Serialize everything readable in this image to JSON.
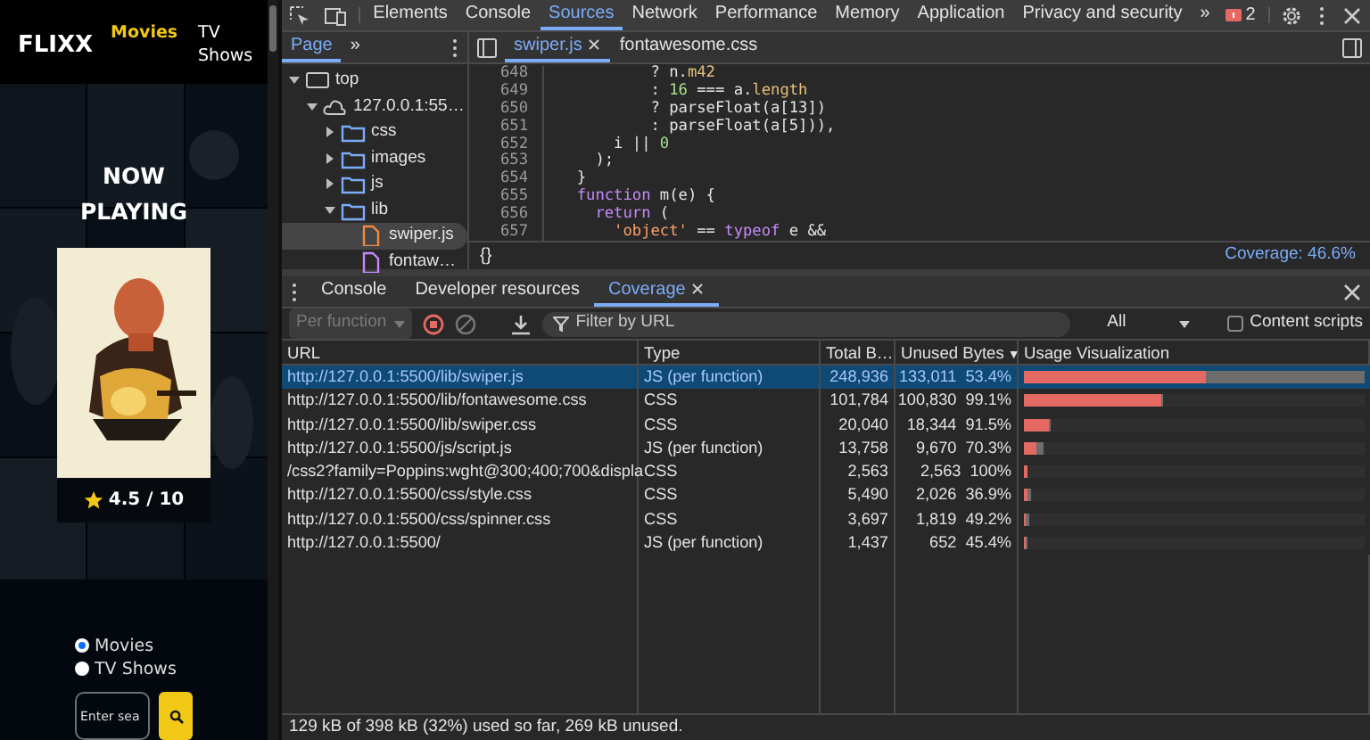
{
  "website": {
    "logo": "FLIXX",
    "nav": [
      {
        "label": "Movies",
        "selected": true
      },
      {
        "label": "TV Shows",
        "selected": false
      }
    ],
    "hero_title": "NOW PLAYING",
    "rating": "4.5 / 10",
    "search_types": [
      {
        "label": "Movies",
        "selected": true
      },
      {
        "label": "TV Shows",
        "selected": false
      }
    ],
    "search": {
      "placeholder": "Enter sea"
    }
  },
  "devtools": {
    "tabs": [
      {
        "label": "Elements",
        "selected": false
      },
      {
        "label": "Console",
        "selected": false
      },
      {
        "label": "Sources",
        "selected": true
      },
      {
        "label": "Network",
        "selected": false
      },
      {
        "label": "Performance",
        "selected": false
      },
      {
        "label": "Memory",
        "selected": false
      },
      {
        "label": "Application",
        "selected": false
      },
      {
        "label": "Privacy and security",
        "selected": false
      }
    ],
    "more_tabs": "»",
    "issues_count": "2",
    "navigator": {
      "tabs": [
        {
          "label": "Page",
          "selected": true
        }
      ],
      "more": "»",
      "tree": [
        {
          "label": "top",
          "kind": "frame",
          "expanded": true,
          "selected": false,
          "children": [
            {
              "label": "127.0.0.1:55…",
              "kind": "origin",
              "expanded": true,
              "selected": false,
              "children": [
                {
                  "label": "css",
                  "kind": "folder",
                  "expanded": false,
                  "selected": false
                },
                {
                  "label": "images",
                  "kind": "folder",
                  "expanded": false,
                  "selected": false
                },
                {
                  "label": "js",
                  "kind": "folder",
                  "expanded": false,
                  "selected": false
                },
                {
                  "label": "lib",
                  "kind": "folder",
                  "expanded": true,
                  "selected": false,
                  "children": [
                    {
                      "label": "swiper.js",
                      "kind": "script",
                      "selected": true
                    },
                    {
                      "label": "fontaw…",
                      "kind": "stylesheet",
                      "selected": false
                    }
                  ]
                }
              ]
            }
          ]
        }
      ]
    },
    "editor": {
      "tabs": [
        {
          "label": "swiper.js",
          "selected": true,
          "closable": true
        },
        {
          "label": "fontawesome.css",
          "selected": false,
          "closable": false
        }
      ],
      "lines": [
        {
          "number": "648",
          "tokens": [
            {
              "text": "          ? n.",
              "kind": "plain"
            },
            {
              "text": "m42",
              "kind": "property"
            }
          ]
        },
        {
          "number": "649",
          "tokens": [
            {
              "text": "          : ",
              "kind": "plain"
            },
            {
              "text": "16",
              "kind": "number"
            },
            {
              "text": " === a.",
              "kind": "plain"
            },
            {
              "text": "length",
              "kind": "property"
            }
          ]
        },
        {
          "number": "650",
          "tokens": [
            {
              "text": "          ? parseFloat(a[13])",
              "kind": "plain"
            }
          ]
        },
        {
          "number": "651",
          "tokens": [
            {
              "text": "          : parseFloat(a[5])),",
              "kind": "plain"
            }
          ]
        },
        {
          "number": "652",
          "tokens": [
            {
              "text": "      i || ",
              "kind": "plain"
            },
            {
              "text": "0",
              "kind": "number"
            }
          ]
        },
        {
          "number": "653",
          "tokens": [
            {
              "text": "    );",
              "kind": "plain"
            }
          ]
        },
        {
          "number": "654",
          "tokens": [
            {
              "text": "  }",
              "kind": "plain"
            }
          ]
        },
        {
          "number": "655",
          "tokens": [
            {
              "text": "  function",
              "kind": "keyword"
            },
            {
              "text": " m(e) {",
              "kind": "plain"
            }
          ]
        },
        {
          "number": "656",
          "tokens": [
            {
              "text": "    return",
              "kind": "keyword"
            },
            {
              "text": " (",
              "kind": "plain"
            }
          ]
        },
        {
          "number": "657",
          "tokens": [
            {
              "text": "      'object'",
              "kind": "string"
            },
            {
              "text": " == ",
              "kind": "plain"
            },
            {
              "text": "typeof",
              "kind": "keyword"
            },
            {
              "text": " e &&",
              "kind": "plain"
            }
          ]
        }
      ],
      "format_button": "{}",
      "coverage": "Coverage: 46.6%"
    },
    "drawer": {
      "tabs": [
        {
          "label": "Console",
          "selected": false,
          "closable": false
        },
        {
          "label": "Developer resources",
          "selected": false,
          "closable": false
        },
        {
          "label": "Coverage",
          "selected": true,
          "closable": true
        }
      ],
      "toolbar": {
        "mode": "Per function",
        "filter_placeholder": "Filter by URL",
        "type_filter": "All",
        "content_scripts": {
          "label": "Content scripts",
          "checked": false
        }
      },
      "columns": [
        {
          "label": "URL"
        },
        {
          "label": "Type"
        },
        {
          "label": "Total B…"
        },
        {
          "label": "Unused Bytes",
          "sort": "▼"
        },
        {
          "label": "Usage Visualization"
        }
      ],
      "rows": [
        {
          "url": "http://127.0.0.1:5500/lib/swiper.js",
          "type": "JS (per function)",
          "total": "248,936",
          "unused": "133,011",
          "percent": "53.4%",
          "selected": true,
          "usage": {
            "level": 1.0
          },
          "unused_bar": {
            "level": 0.534
          }
        },
        {
          "url": "http://127.0.0.1:5500/lib/fontawesome.css",
          "type": "CSS",
          "total": "101,784",
          "unused": "100,830",
          "percent": "99.1%",
          "selected": false,
          "usage": {
            "level": 0.409
          },
          "unused_bar": {
            "level": 0.405
          }
        },
        {
          "url": "http://127.0.0.1:5500/lib/swiper.css",
          "type": "CSS",
          "total": "20,040",
          "unused": "18,344",
          "percent": "91.5%",
          "selected": false,
          "usage": {
            "level": 0.081
          },
          "unused_bar": {
            "level": 0.074
          }
        },
        {
          "url": "http://127.0.0.1:5500/js/script.js",
          "type": "JS (per function)",
          "total": "13,758",
          "unused": "9,670",
          "percent": "70.3%",
          "selected": false,
          "usage": {
            "level": 0.055
          },
          "unused_bar": {
            "level": 0.039
          }
        },
        {
          "url": "/css2?family=Poppins:wght@300;400;700&displa",
          "type": "CSS",
          "total": "2,563",
          "unused": "2,563",
          "percent": "100%",
          "selected": false,
          "usage": {
            "level": 0.012
          },
          "unused_bar": {
            "level": 0.012
          }
        },
        {
          "url": "http://127.0.0.1:5500/css/style.css",
          "type": "CSS",
          "total": "5,490",
          "unused": "2,026",
          "percent": "36.9%",
          "selected": false,
          "usage": {
            "level": 0.022
          },
          "unused_bar": {
            "level": 0.008
          }
        },
        {
          "url": "http://127.0.0.1:5500/css/spinner.css",
          "type": "CSS",
          "total": "3,697",
          "unused": "1,819",
          "percent": "49.2%",
          "selected": false,
          "usage": {
            "level": 0.015
          },
          "unused_bar": {
            "level": 0.007
          }
        },
        {
          "url": "http://127.0.0.1:5500/",
          "type": "JS (per function)",
          "total": "1,437",
          "unused": "652",
          "percent": "45.4%",
          "selected": false,
          "usage": {
            "level": 0.008
          },
          "unused_bar": {
            "level": 0.004
          }
        }
      ],
      "status": "129 kB of 398 kB (32%) used so far, 269 kB unused."
    }
  }
}
